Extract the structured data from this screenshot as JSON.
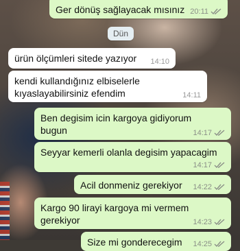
{
  "date_divider": "Dün",
  "messages": [
    {
      "direction": "out",
      "text": "Ger dönüş sağlayacak mısınız",
      "time": "20:11",
      "ticks": "double-check-icon"
    },
    {
      "direction": "in",
      "text": "ürün ölçümleri sitede yazıyor",
      "time": "14:10"
    },
    {
      "direction": "in",
      "text": "kendi kullandığınız elbiselerle kıyaslayabilirsiniz efendim",
      "time": "14:11"
    },
    {
      "direction": "out",
      "text": "Ben degisim icin kargoya gidiyorum bugun",
      "time": "14:17",
      "ticks": "double-check-icon"
    },
    {
      "direction": "out",
      "text": "Seyyar kemerli olanla degisim yapacagim",
      "time": "14:17",
      "ticks": "double-check-icon"
    },
    {
      "direction": "out",
      "text": "Acil donmeniz gerekiyor",
      "time": "14:22",
      "ticks": "double-check-icon"
    },
    {
      "direction": "out",
      "text": "Kargo 90 lirayi kargoya mi vermem gerekiyor",
      "time": "14:23",
      "ticks": "double-check-icon"
    },
    {
      "direction": "out",
      "text": "Size mi gonderecegim",
      "time": "14:25",
      "ticks": "double-check-icon"
    }
  ],
  "colors": {
    "outgoing": "#dcf8c6",
    "incoming": "#ffffff",
    "tick": "#8a8f87"
  }
}
